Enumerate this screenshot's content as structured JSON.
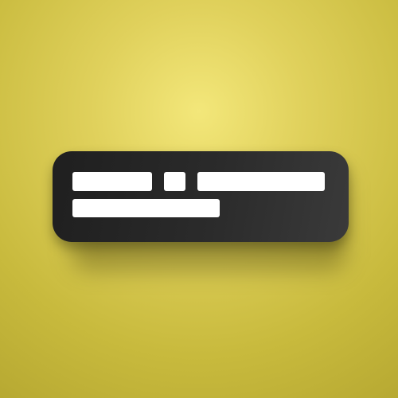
{
  "icon": {
    "name": "text-placeholder-lines-icon",
    "background_color": "#d9cb55",
    "card_color": "#262626",
    "line_color": "#ffffff"
  }
}
